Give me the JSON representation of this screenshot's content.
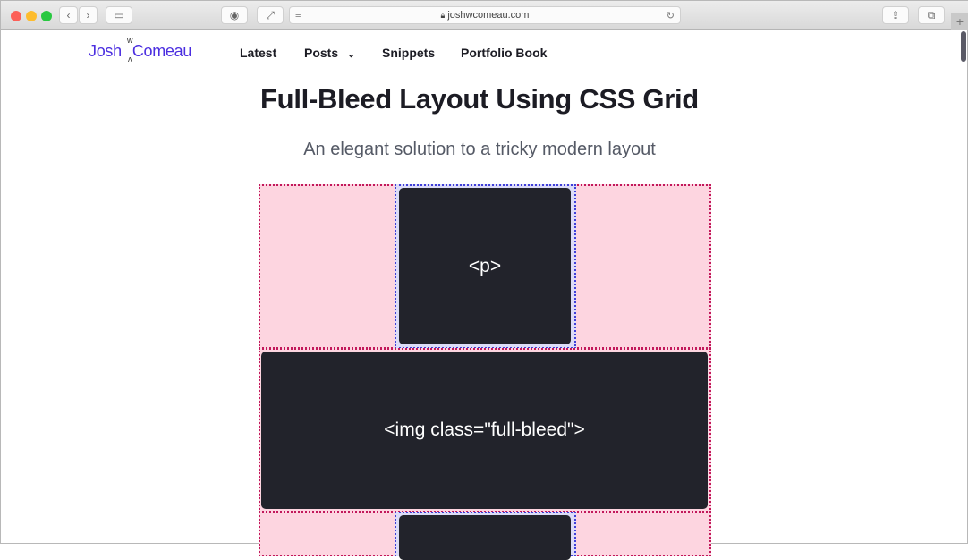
{
  "browser": {
    "url": "joshwcomeau.com"
  },
  "site": {
    "logo_first": "Josh",
    "logo_last": "Comeau",
    "logo_w": "w",
    "logo_a": "ʌ",
    "nav": [
      "Latest",
      "Posts",
      "Snippets",
      "Portfolio Book"
    ]
  },
  "article": {
    "title": "Full-Bleed Layout Using CSS Grid",
    "subtitle": "An elegant solution to a tricky modern layout",
    "diagram": {
      "p_label": "<p>",
      "img_label": "<img class=\"full-bleed\">"
    }
  }
}
